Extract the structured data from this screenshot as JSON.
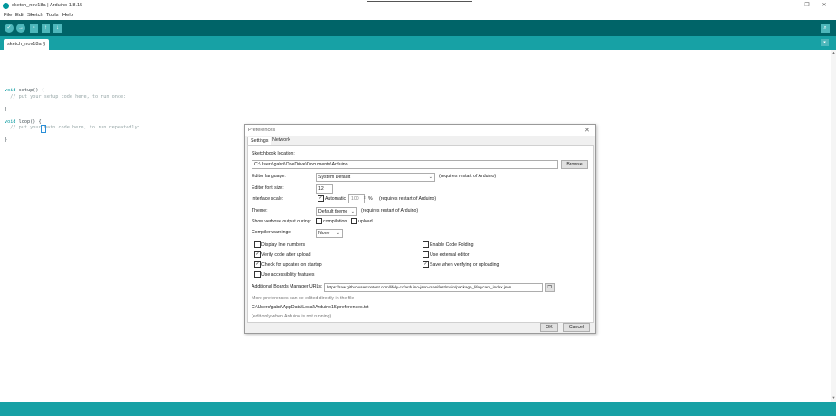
{
  "window": {
    "title": "sketch_nov18a | Arduino 1.8.15",
    "minimize": "–",
    "maximize": "❐",
    "close": "✕"
  },
  "menu": [
    "File",
    "Edit",
    "Sketch",
    "Tools",
    "Help"
  ],
  "toolbar": {
    "verify_glyph": "✓",
    "upload_glyph": "→",
    "new_glyph": "▫",
    "open_glyph": "↑",
    "save_glyph": "↓",
    "serial_glyph": "⌕"
  },
  "tabs": {
    "active": "sketch_nov18a §",
    "menu_glyph": "▾"
  },
  "code": {
    "l1_kw": "void",
    "l1_rest": " setup() {",
    "l2": "  // put your setup code here, to run once:",
    "l4": "}",
    "l6_kw": "void",
    "l6_rest": " loop() {",
    "l7": "  // put your main code here, to run repeatedly:",
    "l9": "}"
  },
  "preferences": {
    "title": "Preferences",
    "close": "✕",
    "tabs": [
      "Settings",
      "Network"
    ],
    "sketchbook_label": "Sketchbook location:",
    "sketchbook_path": "C:\\Users\\gabri\\OneDrive\\Documents\\Arduino",
    "browse": "Browse",
    "editor_language_label": "Editor language:",
    "editor_language_value": "System Default",
    "restart_note": "(requires restart of Arduino)",
    "font_size_label": "Editor font size:",
    "font_size_value": "12",
    "interface_scale_label": "Interface scale:",
    "automatic_label": "Automatic",
    "scale_value": "100",
    "percent": "%",
    "theme_label": "Theme:",
    "theme_value": "Default theme",
    "verbose_label": "Show verbose output during:",
    "compilation_label": "compilation",
    "upload_label": "upload",
    "warnings_label": "Compiler warnings:",
    "warnings_value": "None",
    "checkboxes_left": [
      {
        "label": "Display line numbers",
        "checked": false
      },
      {
        "label": "Verify code after upload",
        "checked": true
      },
      {
        "label": "Check for updates on startup",
        "checked": true
      },
      {
        "label": "Use accessibility features",
        "checked": false
      }
    ],
    "checkboxes_right": [
      {
        "label": "Enable Code Folding",
        "checked": false
      },
      {
        "label": "Use external editor",
        "checked": false
      },
      {
        "label": "Save when verifying or uploading",
        "checked": true
      }
    ],
    "boards_label": "Additional Boards Manager URLs:",
    "boards_url": "https://raw.githubusercontent.com/lifely-cc/arduino-json-manifest/main/package_lifelycam_index.json",
    "more_prefs_note": "More preferences can be edited directly in the file",
    "prefs_file_path": "C:\\Users\\gabri\\AppData\\Local\\Arduino15\\preferences.txt",
    "edit_note": "(edit only when Arduino is not running)",
    "ok": "OK",
    "cancel": "Cancel"
  },
  "colors": {
    "toolbar": "#006468",
    "tabbar": "#17a1a5",
    "button": "#4db7bb",
    "keyword": "#00979c"
  }
}
